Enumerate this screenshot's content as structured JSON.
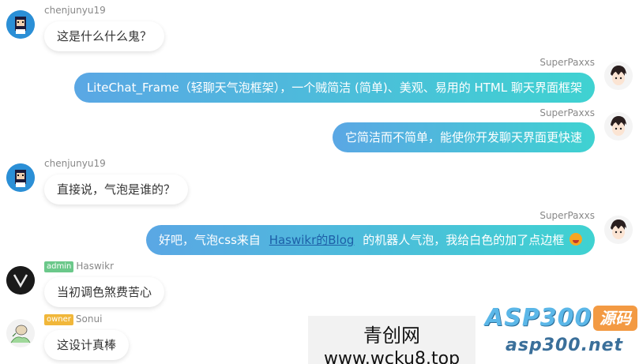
{
  "messages": [
    {
      "user": "chenjunyu19",
      "text": "这是什么什么鬼？",
      "avatar": "pixel-character-avatar"
    },
    {
      "user": "SuperPaxxs",
      "text": "LiteChat_Frame（轻聊天气泡框架），一个贼简洁 (简单)、美观、易用的 HTML 聊天界面框架",
      "avatar": "anime-boy-avatar"
    },
    {
      "user": "SuperPaxxs",
      "text": "它简洁而不简单，能使你开发聊天界面更快速",
      "avatar": "anime-boy-avatar"
    },
    {
      "user": "chenjunyu19",
      "text": "直接说，气泡是谁的？",
      "avatar": "pixel-character-avatar"
    },
    {
      "user": "SuperPaxxs",
      "text_before": "好吧，气泡css来自",
      "link": "Haswikr的Blog",
      "text_after": "的机器人气泡，我给白色的加了点边框",
      "emoji": "grinning-tongue-emoji",
      "avatar": "anime-boy-avatar"
    },
    {
      "badge": "admin",
      "user": "Haswikr",
      "text": "当初调色煞费苦心",
      "avatar": "v-logo-avatar"
    },
    {
      "badge": "owner",
      "user": "Sonui",
      "text": "这设计真棒",
      "avatar": "sketch-avatar"
    }
  ],
  "watermark": {
    "line1": "青创网",
    "line2": "www.wcku8.top"
  },
  "logo": {
    "top": "ASP300",
    "badge": "源码",
    "bottom": "asp300.net"
  },
  "colors": {
    "bubble_gradient_start": "#5aa7e4",
    "bubble_gradient_end": "#3fd2d1",
    "admin_badge": "#6bc88a",
    "owner_badge": "#f1b73a"
  }
}
